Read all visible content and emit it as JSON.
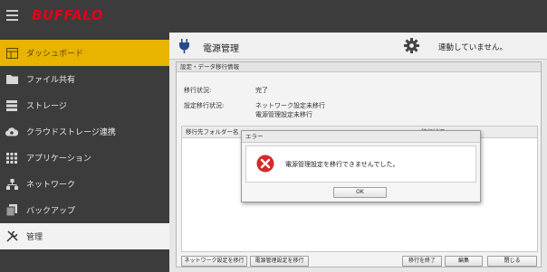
{
  "brand": "BUFFALO",
  "colors": {
    "brand_red": "#e3001b",
    "active_nav": "#e8b400",
    "sidebar_bg": "#3c3c3c",
    "error_red": "#d42a2a"
  },
  "sidebar": {
    "items": [
      {
        "label": "ダッシュボード",
        "icon": "dashboard-icon"
      },
      {
        "label": "ファイル共有",
        "icon": "folder-icon"
      },
      {
        "label": "ストレージ",
        "icon": "storage-icon"
      },
      {
        "label": "クラウドストレージ連携",
        "icon": "cloud-sync-icon"
      },
      {
        "label": "アプリケーション",
        "icon": "apps-grid-icon"
      },
      {
        "label": "ネットワーク",
        "icon": "network-icon"
      },
      {
        "label": "バックアップ",
        "icon": "backup-icon"
      },
      {
        "label": "管理",
        "icon": "tools-icon"
      }
    ]
  },
  "header": {
    "title": "電源管理",
    "status": "連動していません。"
  },
  "panel": {
    "title": "設定・データ移行情報",
    "migration_status_label": "移行状況:",
    "migration_status_value": "完了",
    "settings_label": "設定移行状況:",
    "settings_value_1": "ネットワーク設定未移行",
    "settings_value_2": "電源管理設定未移行",
    "col_folder": "移行先フォルダー名",
    "col_status": "移行状況"
  },
  "buttons": {
    "migrate_network": "ネットワーク設定を移行",
    "migrate_power": "電源管理設定を移行",
    "finish_migration": "移行を終了",
    "edit": "編集",
    "close": "閉じる"
  },
  "dialog": {
    "title": "エラー",
    "message": "電源管理設定を移行できませんでした。",
    "ok": "OK"
  }
}
